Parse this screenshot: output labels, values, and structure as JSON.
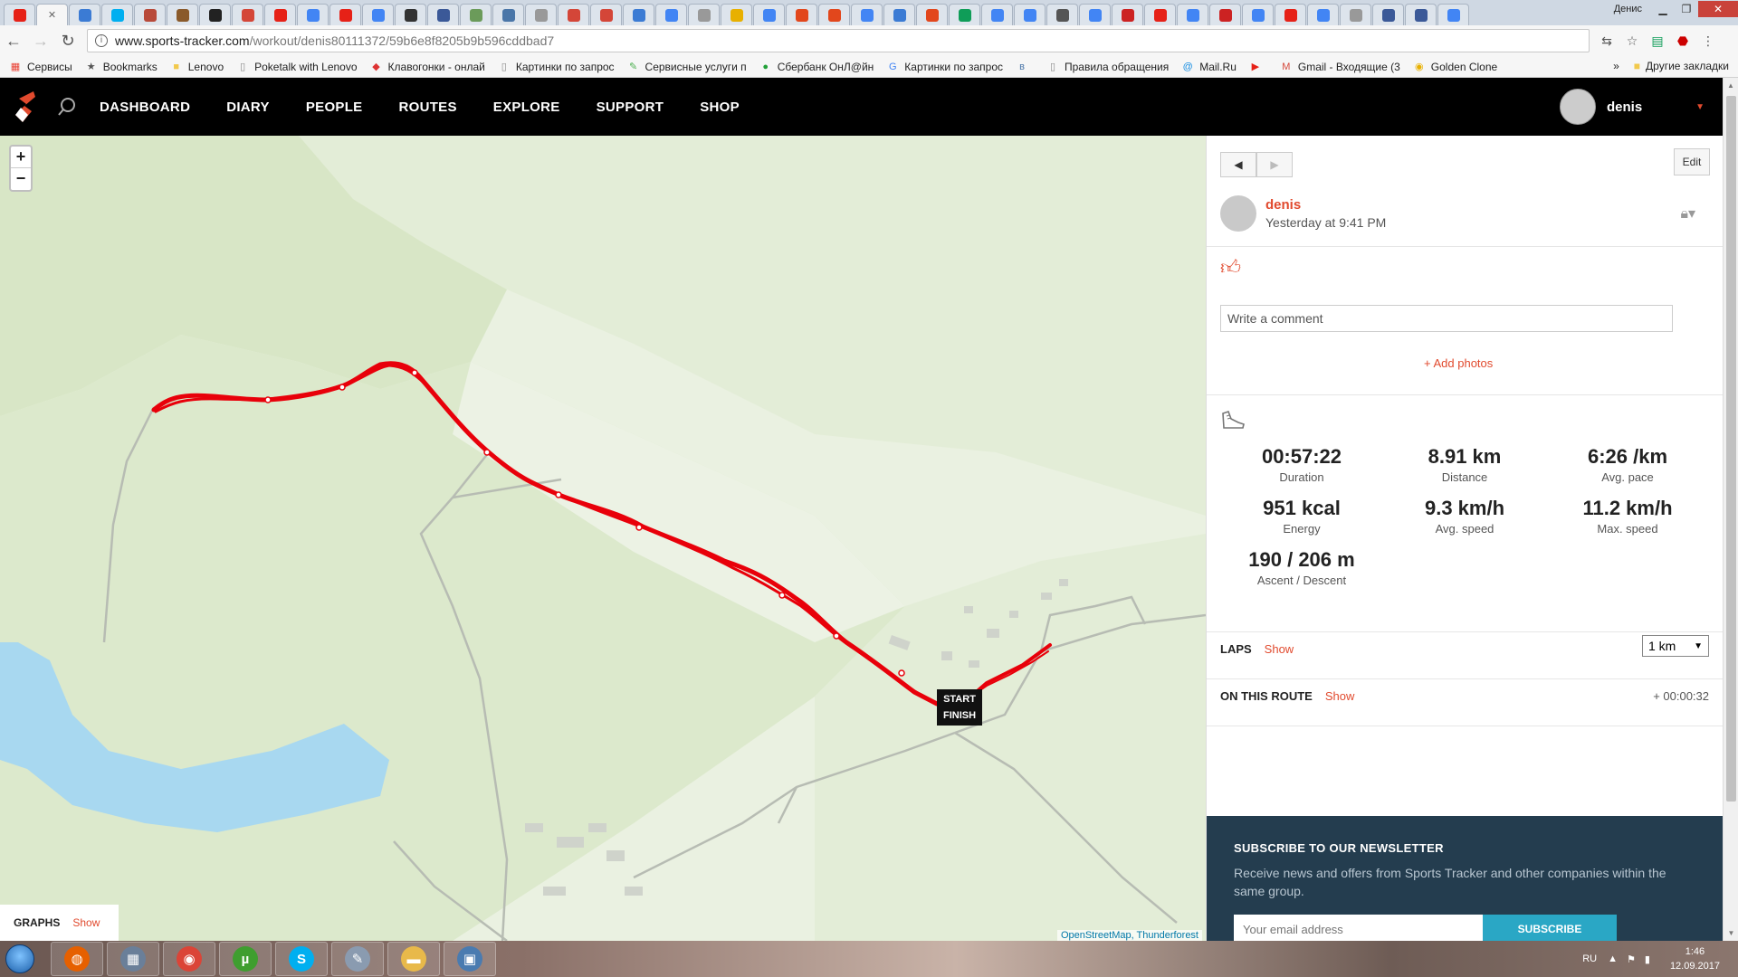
{
  "browser": {
    "tabs": [
      {
        "icon": "youtube-icon",
        "color": "#e62117"
      },
      {
        "icon": "close-icon",
        "color": "#666666",
        "active": true
      },
      {
        "icon": "tree-icon",
        "color": "#3b7bd4"
      },
      {
        "icon": "skype-icon",
        "color": "#00aff0"
      },
      {
        "icon": "page-icon",
        "color": "#b84a3a"
      },
      {
        "icon": "owl-icon",
        "color": "#8a5a2b"
      },
      {
        "icon": "app-icon",
        "color": "#222222"
      },
      {
        "icon": "gmail-icon",
        "color": "#d44638"
      },
      {
        "icon": "youtube-icon",
        "color": "#e62117"
      },
      {
        "icon": "google-icon",
        "color": "#4285f4"
      },
      {
        "icon": "youtube-icon",
        "color": "#e62117"
      },
      {
        "icon": "google-icon",
        "color": "#4285f4"
      },
      {
        "icon": "pause-icon",
        "color": "#333333"
      },
      {
        "icon": "calendar-icon",
        "color": "#3b5998"
      },
      {
        "icon": "image-icon",
        "color": "#6b9b5a"
      },
      {
        "icon": "vk-icon",
        "color": "#4a76a8"
      },
      {
        "icon": "page-icon",
        "color": "#999999"
      },
      {
        "icon": "mail-icon",
        "color": "#d44638"
      },
      {
        "icon": "mail-icon",
        "color": "#d44638"
      },
      {
        "icon": "globe-icon",
        "color": "#3b7bd4"
      },
      {
        "icon": "google-icon",
        "color": "#4285f4"
      },
      {
        "icon": "page-icon",
        "color": "#999999"
      },
      {
        "icon": "feather-icon",
        "color": "#e8b000"
      },
      {
        "icon": "google-icon",
        "color": "#4285f4"
      },
      {
        "icon": "dot-icon",
        "color": "#e2471c"
      },
      {
        "icon": "news-icon",
        "color": "#e2471c"
      },
      {
        "icon": "google-icon",
        "color": "#4285f4"
      },
      {
        "icon": "diamond-icon",
        "color": "#3b7bd4"
      },
      {
        "icon": "news-icon",
        "color": "#e2471c"
      },
      {
        "icon": "sheet-icon",
        "color": "#0f9d58"
      },
      {
        "icon": "google-icon",
        "color": "#4285f4"
      },
      {
        "icon": "google-icon",
        "color": "#4285f4"
      },
      {
        "icon": "search-icon",
        "color": "#555555"
      },
      {
        "icon": "google-icon",
        "color": "#4285f4"
      },
      {
        "icon": "ruby-icon",
        "color": "#cc2222"
      },
      {
        "icon": "youtube-icon",
        "color": "#e62117"
      },
      {
        "icon": "google-icon",
        "color": "#4285f4"
      },
      {
        "icon": "link-icon",
        "color": "#cc2222"
      },
      {
        "icon": "google-icon",
        "color": "#4285f4"
      },
      {
        "icon": "youtube-icon",
        "color": "#e62117"
      },
      {
        "icon": "google-icon",
        "color": "#4285f4"
      },
      {
        "icon": "page-icon",
        "color": "#999999"
      },
      {
        "icon": "edit-icon",
        "color": "#3b5998"
      },
      {
        "icon": "edit-icon",
        "color": "#3b5998"
      },
      {
        "icon": "google-icon",
        "color": "#4285f4"
      }
    ],
    "window_user": "Денис",
    "url_host": "www.sports-tracker.com",
    "url_path": "/workout/denis80111372/59b6e8f8205b9b596cddbad7",
    "bookmarks": [
      {
        "label": "Сервисы",
        "icon": "apps-icon"
      },
      {
        "label": "Bookmarks",
        "icon": "star-icon"
      },
      {
        "label": "Lenovo",
        "icon": "folder-icon"
      },
      {
        "label": "Poketalk with Lenovo",
        "icon": "page-icon"
      },
      {
        "label": "Клавогонки - онлай",
        "icon": "car-icon"
      },
      {
        "label": "Картинки по запрос",
        "icon": "page-icon"
      },
      {
        "label": "Сервисные услуги п",
        "icon": "feather-icon"
      },
      {
        "label": "Сбербанк ОнЛ@йн",
        "icon": "sber-icon"
      },
      {
        "label": "Картинки по запрос",
        "icon": "google-icon"
      },
      {
        "label": "",
        "icon": "vk-icon"
      },
      {
        "label": "Правила обращения",
        "icon": "page-icon"
      },
      {
        "label": "Mail.Ru",
        "icon": "mailru-icon"
      },
      {
        "label": "",
        "icon": "youtube-icon"
      },
      {
        "label": "Gmail - Входящие (3",
        "icon": "gmail-icon"
      },
      {
        "label": "Golden Clone",
        "icon": "coin-icon"
      }
    ],
    "bookmarks_other": "Другие закладки"
  },
  "site": {
    "nav": [
      "DASHBOARD",
      "DIARY",
      "PEOPLE",
      "ROUTES",
      "EXPLORE",
      "SUPPORT",
      "SHOP"
    ],
    "user": "denis",
    "brand_color": "#e14a2e"
  },
  "map": {
    "marker_lines": [
      "START",
      "FINISH"
    ],
    "attribution": "OpenStreetMap, Thunderforest",
    "graphs_label": "GRAPHS",
    "graphs_show": "Show",
    "zoom_in": "+",
    "zoom_out": "−"
  },
  "workout": {
    "edit_label": "Edit",
    "author": "denis",
    "time": "Yesterday at 9:41 PM",
    "comment_placeholder": "Write a comment",
    "add_photos": "+ Add photos",
    "stats": [
      {
        "value": "00:57:22",
        "label": "Duration"
      },
      {
        "value": "8.91 km",
        "label": "Distance"
      },
      {
        "value": "6:26 /km",
        "label": "Avg. pace"
      },
      {
        "value": "951 kcal",
        "label": "Energy"
      },
      {
        "value": "9.3 km/h",
        "label": "Avg. speed"
      },
      {
        "value": "11.2 km/h",
        "label": "Max. speed"
      },
      {
        "value": "190 / 206 m",
        "label": "Ascent / Descent"
      }
    ],
    "laps_label": "LAPS",
    "laps_show": "Show",
    "laps_unit": "1 km",
    "route_label": "ON THIS ROUTE",
    "route_show": "Show",
    "route_delta": "+ 00:00:32"
  },
  "newsletter": {
    "title": "SUBSCRIBE TO OUR NEWSLETTER",
    "text": "Receive news and offers from Sports Tracker and other companies within the same group.",
    "email_placeholder": "Your email address",
    "submit": "SUBSCRIBE"
  },
  "taskbar": {
    "apps": [
      {
        "icon": "firefox-icon",
        "color": "#e66000"
      },
      {
        "icon": "calculator-icon",
        "color": "#6a7f99"
      },
      {
        "icon": "chrome-icon",
        "color": "#db4437"
      },
      {
        "icon": "utorrent-icon",
        "color": "#3f9e2f"
      },
      {
        "icon": "skype-icon",
        "color": "#00aff0"
      },
      {
        "icon": "paint-icon",
        "color": "#8a9bb0"
      },
      {
        "icon": "explorer-icon",
        "color": "#e8b94a"
      },
      {
        "icon": "picture-icon",
        "color": "#4a7bb0"
      }
    ],
    "lang": "RU",
    "time": "1:46",
    "date": "12.09.2017"
  }
}
